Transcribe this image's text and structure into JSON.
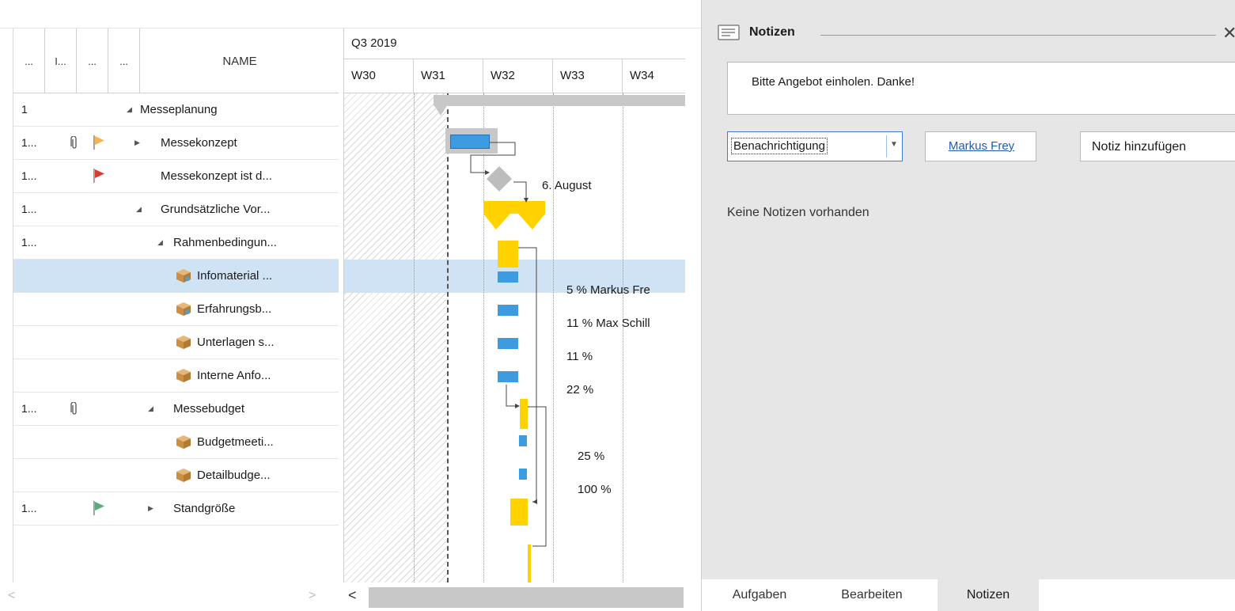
{
  "grid": {
    "header": {
      "col1": "...",
      "col2": "I...",
      "col3": "...",
      "col4": "...",
      "name": "NAME"
    },
    "rows": [
      {
        "id": "1",
        "label": "Messeplanung",
        "expander": "◢"
      },
      {
        "id": "1...",
        "label": "Messekonzept",
        "expander": "▶"
      },
      {
        "id": "1...",
        "label": "Messekonzept ist d...",
        "expander": ""
      },
      {
        "id": "1...",
        "label": "Grundsätzliche Vor...",
        "expander": "◢"
      },
      {
        "id": "1...",
        "label": "Rahmenbedingun...",
        "expander": "◢"
      },
      {
        "id": "",
        "label": "Infomaterial ...",
        "expander": ""
      },
      {
        "id": "",
        "label": "Erfahrungsb...",
        "expander": ""
      },
      {
        "id": "",
        "label": "Unterlagen s...",
        "expander": ""
      },
      {
        "id": "",
        "label": "Interne Anfo...",
        "expander": ""
      },
      {
        "id": "1...",
        "label": "Messebudget",
        "expander": "◢"
      },
      {
        "id": "",
        "label": "Budgetmeeti...",
        "expander": ""
      },
      {
        "id": "",
        "label": "Detailbudge...",
        "expander": ""
      },
      {
        "id": "1...",
        "label": "Standgröße",
        "expander": "▶"
      }
    ],
    "scroll_left": "<",
    "scroll_right": ">"
  },
  "gantt": {
    "quarter": "Q3 2019",
    "weeks": [
      "W30",
      "W31",
      "W32",
      "W33",
      "W34"
    ],
    "labels": {
      "milestone": "6. August",
      "infomaterial": "5 % Markus Fre",
      "erfahrung": "11 % Max Schill",
      "unterlagen": "11 %",
      "interne": "22 %",
      "budgetmeeting": "25 %",
      "detailbudget": "100 %"
    },
    "scroll_arrow": "<"
  },
  "notes": {
    "title": "Notizen",
    "close": "✕",
    "note_text": "Bitte Angebot einholen. Danke!",
    "type_value": "Benachrichtigung",
    "user": "Markus Frey",
    "add_button": "Notiz hinzufügen",
    "empty_message": "Keine Notizen vorhanden",
    "tabs": [
      "Aufgaben",
      "Bearbeiten",
      "Notizen"
    ],
    "active_tab": "Notizen"
  },
  "colors": {
    "selection": "#cfe3f5",
    "bar_blue": "#3d9be0",
    "bar_yellow": "#ffd200",
    "flag_orange": "#f4b455",
    "flag_red": "#e0392f",
    "flag_green": "#5daa78",
    "link": "#1a5fb4"
  }
}
